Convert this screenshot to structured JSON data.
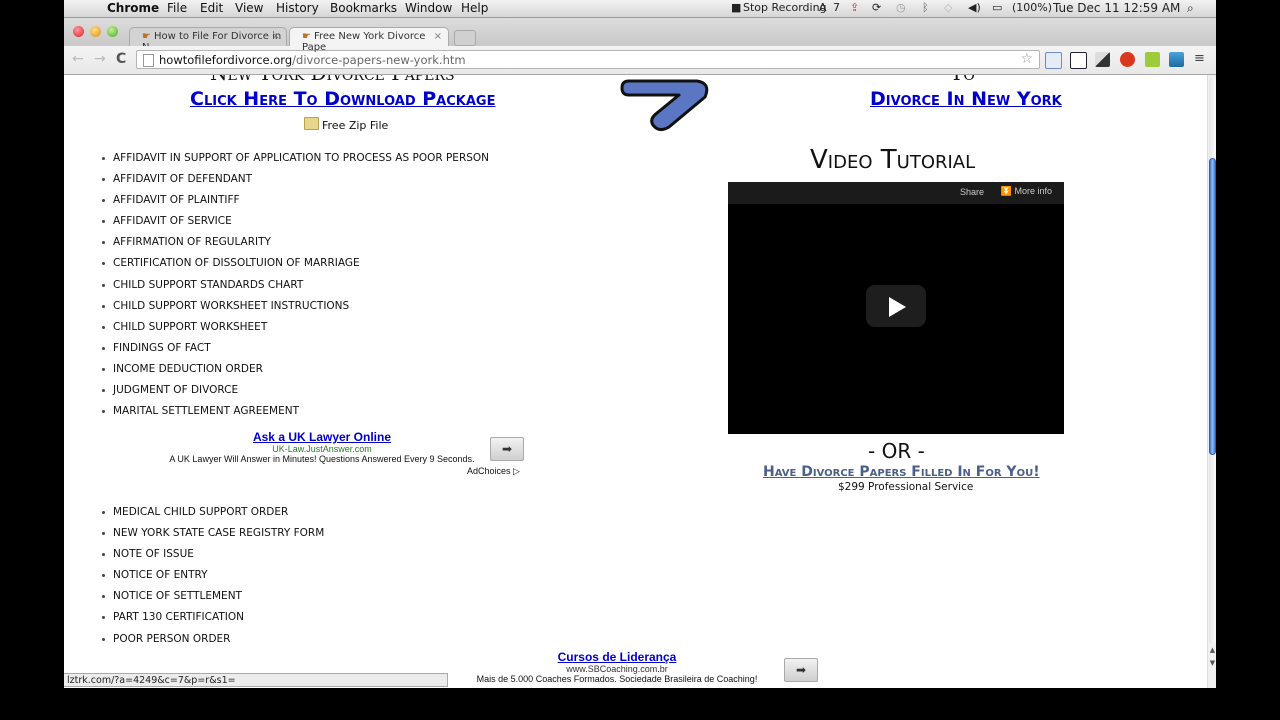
{
  "menubar": {
    "app_name": "Chrome",
    "items": [
      "File",
      "Edit",
      "View",
      "History",
      "Bookmarks",
      "Window",
      "Help"
    ],
    "stop_recording": "Stop Recording",
    "adobe_count": "7",
    "battery": "(100%)",
    "datetime": "Tue Dec 11  12:59 AM"
  },
  "tabs": [
    {
      "title": "How to File For Divorce in N",
      "active": false
    },
    {
      "title": "Free New York Divorce Pape",
      "active": true
    }
  ],
  "toolbar": {
    "url_host": "howtofilefordivorce.org",
    "url_path": "/divorce-papers-new-york.htm"
  },
  "page": {
    "left_heading": "New York Divorce Papers",
    "download_link": "Click Here To Download Package",
    "zip_label": "Free Zip File",
    "forms_list_1": [
      "AFFIDAVIT IN SUPPORT OF APPLICATION TO PROCESS AS POOR PERSON",
      "AFFIDAVIT OF DEFENDANT",
      "AFFIDAVIT OF PLAINTIFF",
      "AFFIDAVIT OF SERVICE",
      "AFFIRMATION OF REGULARITY",
      "CERTIFICATION OF DISSOLTUION OF MARRIAGE",
      "CHILD SUPPORT STANDARDS CHART",
      "CHILD SUPPORT WORKSHEET INSTRUCTIONS",
      "CHILD SUPPORT WORKSHEET",
      "FINDINGS OF FACT",
      "INCOME DEDUCTION ORDER",
      "JUDGMENT OF DIVORCE",
      "MARITAL SETTLEMENT AGREEMENT"
    ],
    "ad1": {
      "title": "Ask a UK Lawyer Online",
      "url": "UK-Law.JustAnswer.com",
      "desc": "A UK Lawyer Will Answer in Minutes! Questions Answered Every 9 Seconds.",
      "adchoices": "AdChoices"
    },
    "forms_list_2": [
      "MEDICAL CHILD SUPPORT ORDER",
      "NEW YORK STATE CASE REGISTRY FORM",
      "NOTE OF ISSUE",
      "NOTICE OF ENTRY",
      "NOTICE OF SETTLEMENT",
      "PART 130 CERTIFICATION",
      "POOR PERSON ORDER"
    ],
    "ad2": {
      "title": "Cursos de Liderança",
      "url": "www.SBCoaching.com.br",
      "desc": "Mais de 5.000 Coaches Formados. Sociedade Brasileira de Coaching!"
    },
    "right_heading": "To",
    "divorce_link": "Divorce In New York",
    "video_title": "Video Tutorial",
    "video": {
      "share": "Share",
      "more_info": "More info"
    },
    "or_text": "- OR -",
    "filled_link": "Have Divorce Papers Filled In For You!",
    "price_text": "$299 Professional Service"
  },
  "status_url": "lztrk.com/?a=4249&c=7&p=r&s1=",
  "scroll_position": 0.3
}
